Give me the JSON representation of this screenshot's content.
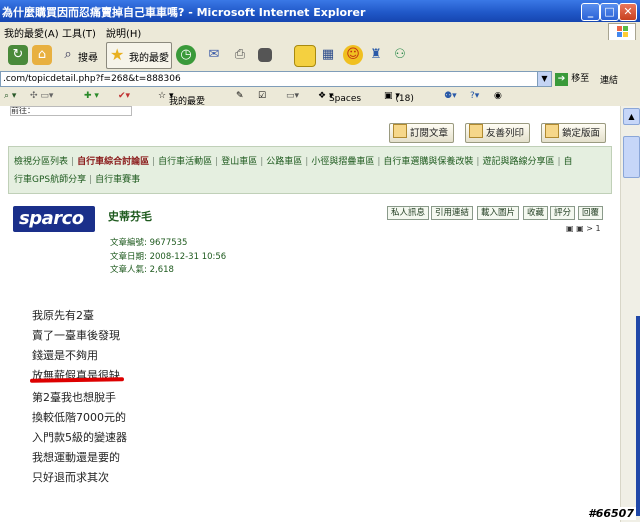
{
  "window": {
    "title": "為什麼購買因而忍痛賣掉自己車車嗎? - Microsoft Internet Explorer",
    "btn_min": "_",
    "btn_max": "□",
    "btn_close": "✕"
  },
  "menu": {
    "items": [
      "我的最愛(A)",
      "工具(T)",
      "說明(H)"
    ]
  },
  "toolbar": {
    "search_label": "搜尋",
    "favorites_label": "我的最愛"
  },
  "address": {
    "url": ".com/topicdetail.php?f=268&t=888306",
    "go_label": "移至",
    "links_label": "連結"
  },
  "google_bar": {
    "favorites": "我的最愛",
    "spaces": "Spaces",
    "count": "(18)"
  },
  "page": {
    "breadcrumb": "前往：",
    "actions": [
      "訂閱文章",
      "友善列印",
      "鎖定版面"
    ],
    "categories_line1": [
      "檢視分區列表",
      "自行車綜合討論區",
      "自行車活動區",
      "登山車區",
      "公路車區",
      "小徑與摺疊車區",
      "自行車選購與保養改裝",
      "遊記與路線分享區",
      "自"
    ],
    "categories_line2": [
      "行車GPS航師分享",
      "自行車賽事"
    ],
    "active_category": "自行車綜合討論區",
    "logo_text": "sparco",
    "username": "史蒂芬毛",
    "user_buttons": [
      "私人訊息",
      "引用連結",
      "載入圖片",
      "收藏",
      "評分",
      "回覆"
    ],
    "pager": "▣ ▣ > 1",
    "meta": {
      "id_label": "文章編號",
      "id_value": "9677535",
      "date_label": "文章日期",
      "date_value": "2008-12-31 10:56",
      "views_label": "文章人氣",
      "views_value": "2,618"
    },
    "post_lines": [
      "我原先有2臺",
      "賣了一臺車後發現",
      "錢還是不夠用",
      "放無薪假真是很缺",
      "第2臺我也想脫手",
      "換較低階7000元的",
      "入門款5級的變速器",
      "我想運動還是要的",
      "只好退而求其次"
    ]
  },
  "watermark": "#66507",
  "colors": {
    "accent_green": "#1e5a1e",
    "active_red": "#8a1a1a",
    "xp_blue": "#1f56c6"
  }
}
